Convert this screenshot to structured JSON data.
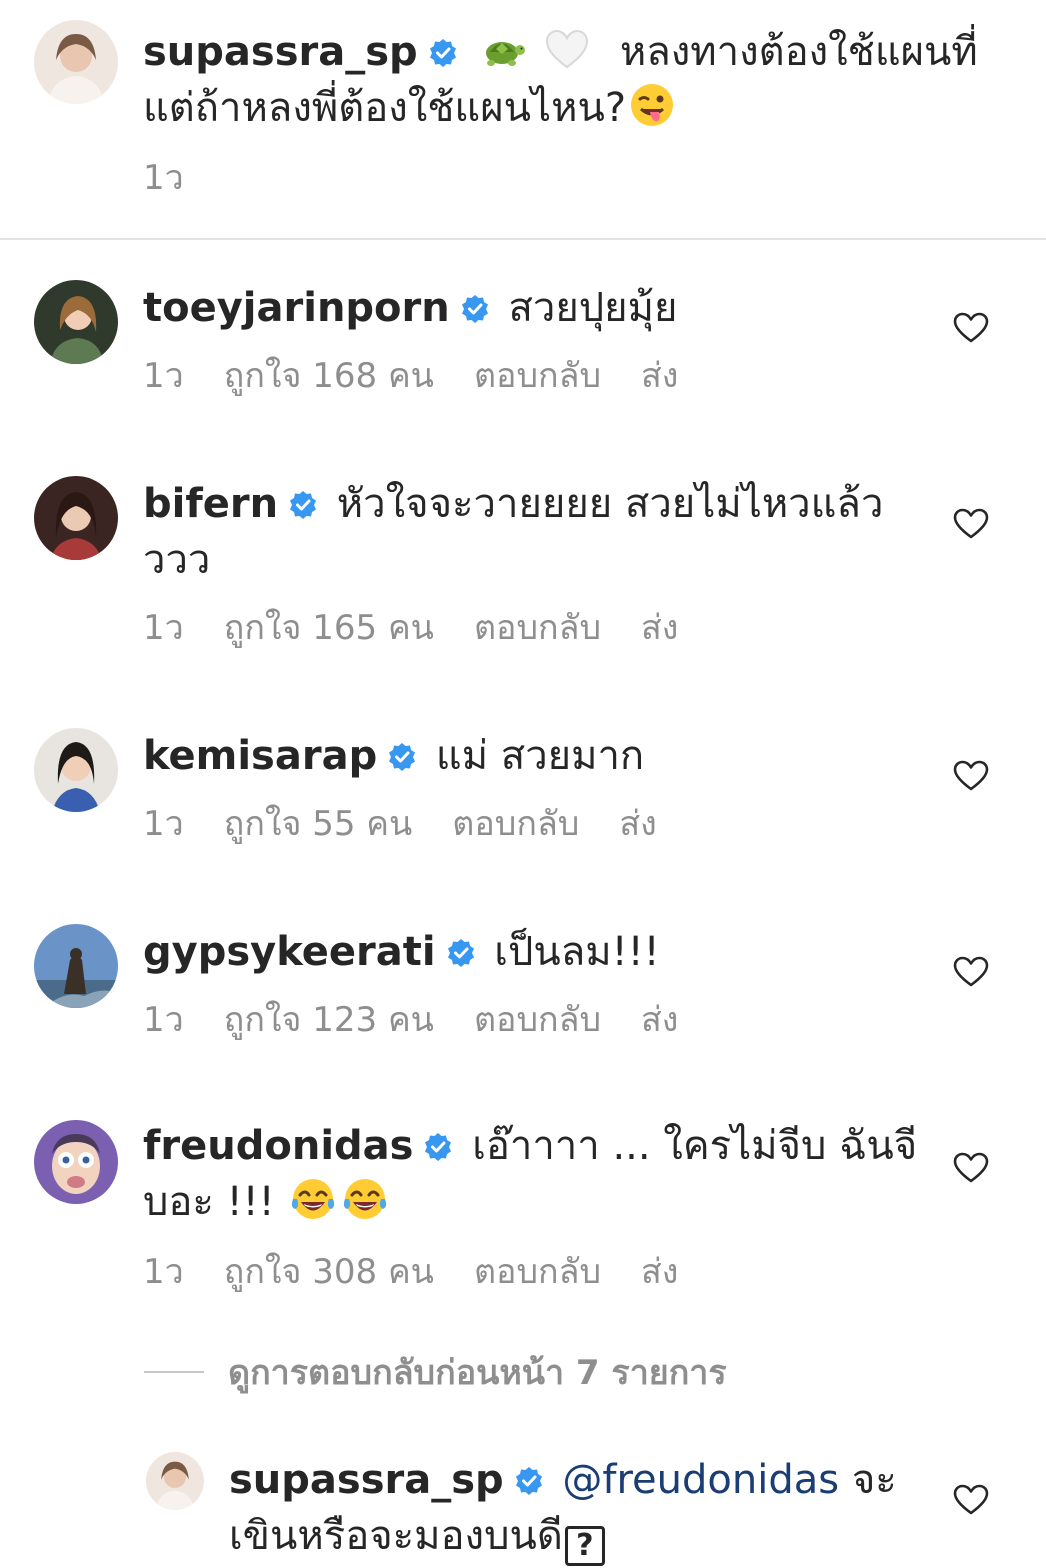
{
  "caption": {
    "username": "supassra_sp",
    "text_line1": "หลงทางต้องใช้แผนที่",
    "text_line2": "แต่ถ้าหลงพี่ต้องใช้แผนไหน?",
    "time": "1ว",
    "icons": [
      "verified-badge-icon",
      "turtle-emoji",
      "white-heart-emoji",
      "winking-tongue-emoji"
    ]
  },
  "comments": [
    {
      "username": "toeyjarinporn",
      "text": "สวยปุยมุ้ย",
      "time": "1ว",
      "likes": "ถูกใจ 168 คน",
      "reply": "ตอบกลับ",
      "send": "ส่ง"
    },
    {
      "username": "bifern",
      "text_line1": "หัวใจจะวายยยย สวยไม่ไหวแล้ว",
      "text_line2": "ววว",
      "time": "1ว",
      "likes": "ถูกใจ 165 คน",
      "reply": "ตอบกลับ",
      "send": "ส่ง"
    },
    {
      "username": "kemisarap",
      "text": "แม่ สวยมาก",
      "time": "1ว",
      "likes": "ถูกใจ 55 คน",
      "reply": "ตอบกลับ",
      "send": "ส่ง"
    },
    {
      "username": "gypsykeerati",
      "text": "เป็นลม!!!",
      "time": "1ว",
      "likes": "ถูกใจ 123 คน",
      "reply": "ตอบกลับ",
      "send": "ส่ง"
    },
    {
      "username": "freudonidas",
      "text_line1": "เอ๊าาาา ... ใครไม่จีบ ฉันจี",
      "text_line2": "บอะ !!!",
      "time": "1ว",
      "likes": "ถูกใจ 308 คน",
      "reply": "ตอบกลับ",
      "send": "ส่ง"
    }
  ],
  "view_replies": "ดูการตอบกลับก่อนหน้า 7 รายการ",
  "reply": {
    "username": "supassra_sp",
    "mention": "@freudonidas",
    "text_line1": "จะ",
    "text_line2": "เขินหรือจะมองบนดี",
    "box_glyph": "?"
  },
  "colors": {
    "verified": "#3897f0",
    "meta": "#8e8e8e",
    "mention": "#1a3d73",
    "text": "#262626"
  }
}
